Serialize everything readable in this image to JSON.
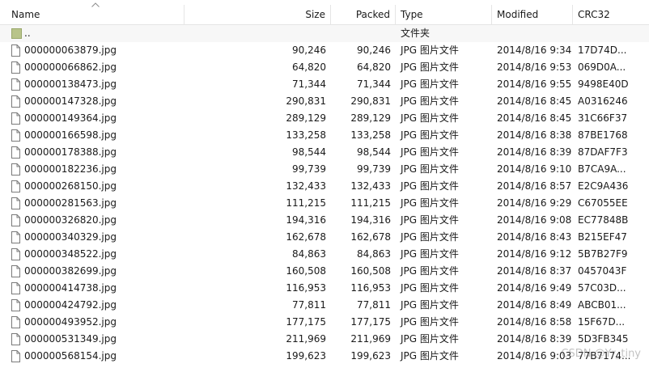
{
  "columns": {
    "name": "Name",
    "size": "Size",
    "packed": "Packed",
    "type": "Type",
    "modified": "Modified",
    "crc": "CRC32"
  },
  "parent_row": {
    "name": "..",
    "type": "文件夹"
  },
  "files": [
    {
      "name": "000000063879.jpg",
      "size": "90,246",
      "packed": "90,246",
      "type": "JPG 图片文件",
      "modified": "2014/8/16 9:34",
      "crc": "17D74D..."
    },
    {
      "name": "000000066862.jpg",
      "size": "64,820",
      "packed": "64,820",
      "type": "JPG 图片文件",
      "modified": "2014/8/16 9:53",
      "crc": "069D0A..."
    },
    {
      "name": "000000138473.jpg",
      "size": "71,344",
      "packed": "71,344",
      "type": "JPG 图片文件",
      "modified": "2014/8/16 9:55",
      "crc": "9498E40D"
    },
    {
      "name": "000000147328.jpg",
      "size": "290,831",
      "packed": "290,831",
      "type": "JPG 图片文件",
      "modified": "2014/8/16 8:45",
      "crc": "A0316246"
    },
    {
      "name": "000000149364.jpg",
      "size": "289,129",
      "packed": "289,129",
      "type": "JPG 图片文件",
      "modified": "2014/8/16 8:45",
      "crc": "31C66F37"
    },
    {
      "name": "000000166598.jpg",
      "size": "133,258",
      "packed": "133,258",
      "type": "JPG 图片文件",
      "modified": "2014/8/16 8:38",
      "crc": "87BE1768"
    },
    {
      "name": "000000178388.jpg",
      "size": "98,544",
      "packed": "98,544",
      "type": "JPG 图片文件",
      "modified": "2014/8/16 8:39",
      "crc": "87DAF7F3"
    },
    {
      "name": "000000182236.jpg",
      "size": "99,739",
      "packed": "99,739",
      "type": "JPG 图片文件",
      "modified": "2014/8/16 9:10",
      "crc": "B7CA9A..."
    },
    {
      "name": "000000268150.jpg",
      "size": "132,433",
      "packed": "132,433",
      "type": "JPG 图片文件",
      "modified": "2014/8/16 8:57",
      "crc": "E2C9A436"
    },
    {
      "name": "000000281563.jpg",
      "size": "111,215",
      "packed": "111,215",
      "type": "JPG 图片文件",
      "modified": "2014/8/16 9:29",
      "crc": "C67055EE"
    },
    {
      "name": "000000326820.jpg",
      "size": "194,316",
      "packed": "194,316",
      "type": "JPG 图片文件",
      "modified": "2014/8/16 9:08",
      "crc": "EC77848B"
    },
    {
      "name": "000000340329.jpg",
      "size": "162,678",
      "packed": "162,678",
      "type": "JPG 图片文件",
      "modified": "2014/8/16 8:43",
      "crc": "B215EF47"
    },
    {
      "name": "000000348522.jpg",
      "size": "84,863",
      "packed": "84,863",
      "type": "JPG 图片文件",
      "modified": "2014/8/16 9:12",
      "crc": "5B7B27F9"
    },
    {
      "name": "000000382699.jpg",
      "size": "160,508",
      "packed": "160,508",
      "type": "JPG 图片文件",
      "modified": "2014/8/16 8:37",
      "crc": "0457043F"
    },
    {
      "name": "000000414738.jpg",
      "size": "116,953",
      "packed": "116,953",
      "type": "JPG 图片文件",
      "modified": "2014/8/16 9:49",
      "crc": "57C03D..."
    },
    {
      "name": "000000424792.jpg",
      "size": "77,811",
      "packed": "77,811",
      "type": "JPG 图片文件",
      "modified": "2014/8/16 8:49",
      "crc": "ABCB01..."
    },
    {
      "name": "000000493952.jpg",
      "size": "177,175",
      "packed": "177,175",
      "type": "JPG 图片文件",
      "modified": "2014/8/16 8:58",
      "crc": "15F67D..."
    },
    {
      "name": "000000531349.jpg",
      "size": "211,969",
      "packed": "211,969",
      "type": "JPG 图片文件",
      "modified": "2014/8/16 8:39",
      "crc": "5D3FB345"
    },
    {
      "name": "000000568154.jpg",
      "size": "199,623",
      "packed": "199,623",
      "type": "JPG 图片文件",
      "modified": "2014/8/16 9:03",
      "crc": "77B7174..."
    }
  ],
  "watermark": "CSDN @Yr_tiny",
  "colors": {
    "folder": "#b8c48a",
    "header_border": "#e5e5e5",
    "parent_row_bg": "#f7f7f7"
  },
  "icons": {
    "folder": "folder-icon",
    "file": "file-icon",
    "sort": "sort-up-arrow-icon"
  }
}
